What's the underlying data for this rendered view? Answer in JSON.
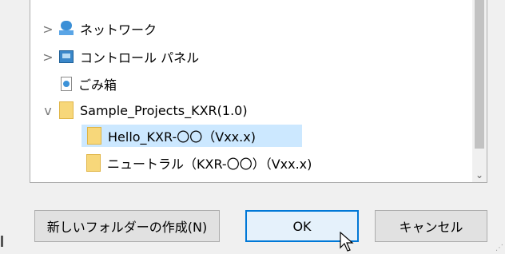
{
  "tree": {
    "items": [
      {
        "label": "ネットワーク",
        "expander": ">",
        "icon": "network-icon"
      },
      {
        "label": "コントロール パネル",
        "expander": ">",
        "icon": "control-panel-icon"
      },
      {
        "label": "ごみ箱",
        "expander": "",
        "icon": "recycle-bin-icon"
      },
      {
        "label": "Sample_Projects_KXR(1.0)",
        "expander": "v",
        "icon": "folder-icon"
      },
      {
        "label": "Hello_KXR-〇〇（Vxx.x)",
        "expander": "",
        "icon": "folder-icon",
        "selected": true
      },
      {
        "label": "ニュートラル（KXR-〇〇）（Vxx.x)",
        "expander": "",
        "icon": "folder-icon"
      }
    ]
  },
  "buttons": {
    "new_folder": "新しいフォルダーの作成(N)",
    "ok": "OK",
    "cancel": "キャンセル"
  },
  "colors": {
    "selection": "#cce8ff",
    "default_button_border": "#0078d7",
    "folder": "#f7d77a"
  }
}
